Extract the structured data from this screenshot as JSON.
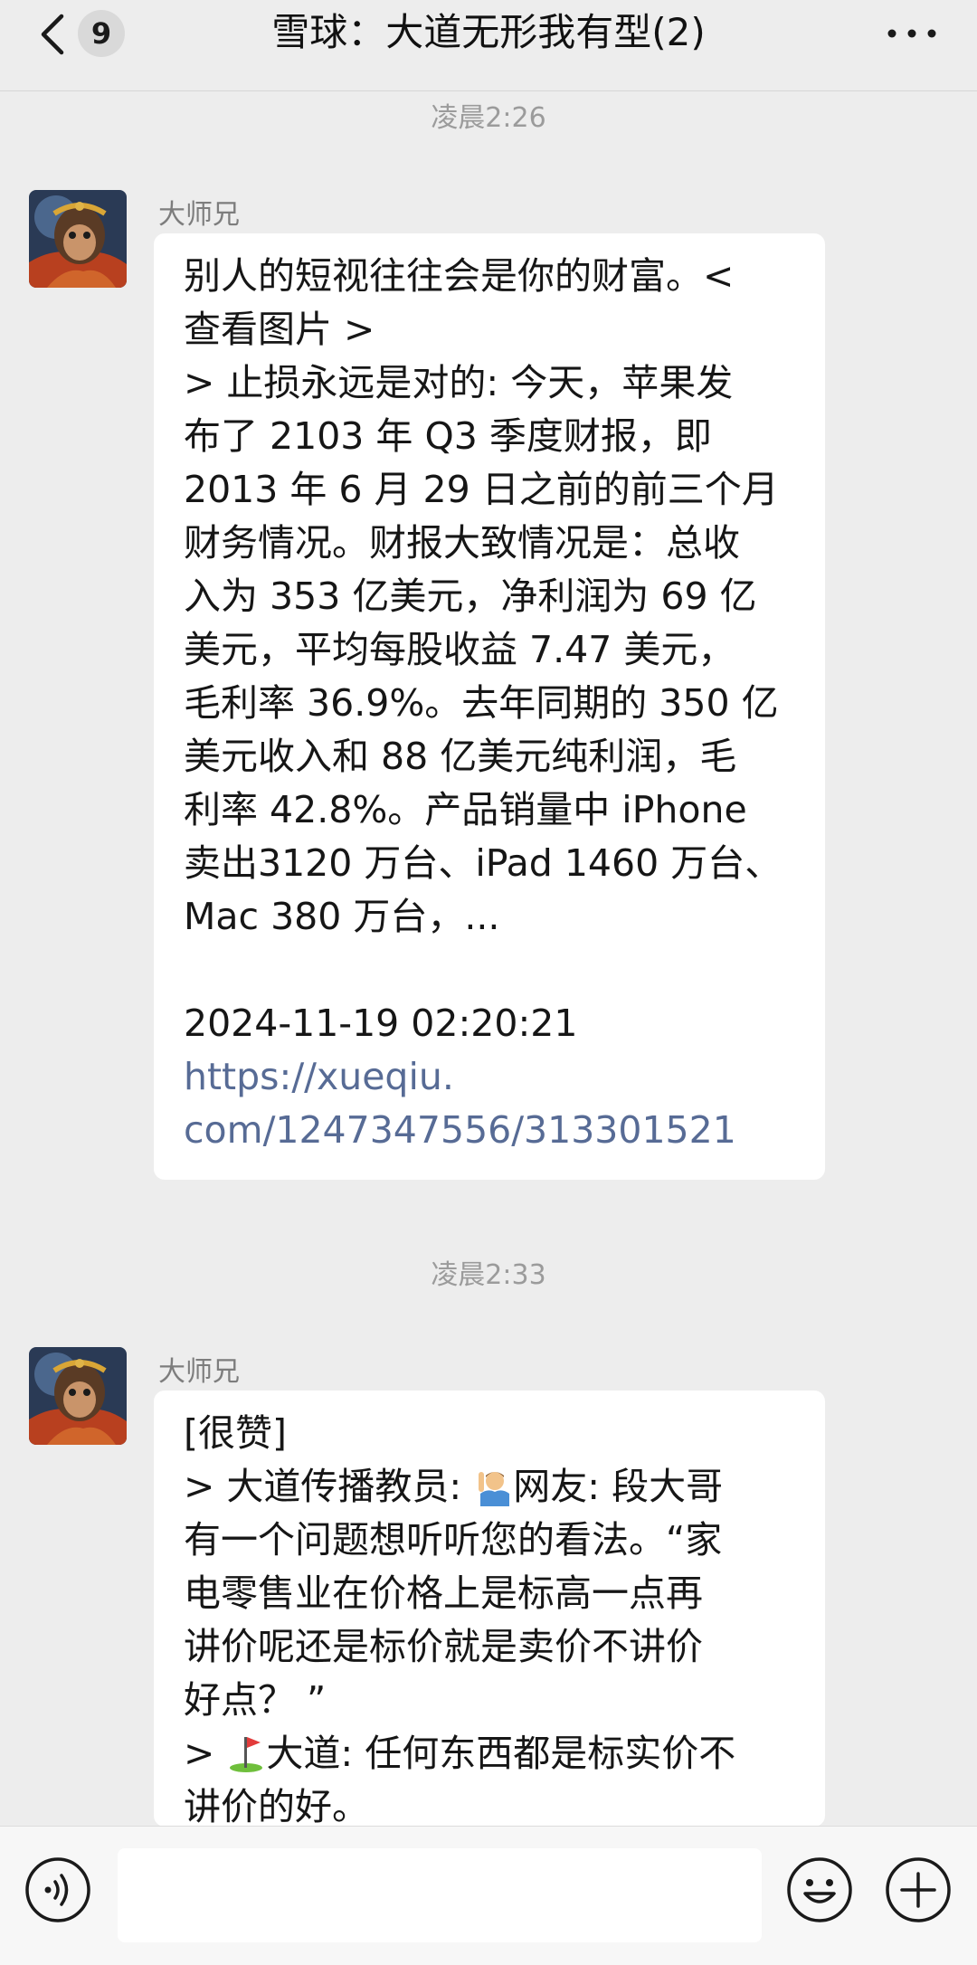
{
  "header": {
    "unread_count": "9",
    "title": "雪球：大道无形我有型(2)",
    "back_icon": "chevron-left-icon",
    "more_icon": "more-dots-icon"
  },
  "messages": [
    {
      "time": "凌晨2:26",
      "sender": "大师兄",
      "lines": [
        "别人的短视往往会是你的财富。<",
        "查看图片 >",
        "> 止损永远是对的: 今天，苹果发",
        "布了 2103 年 Q3 季度财报，即",
        "2013 年 6 月 29 日之前的前三个月",
        "财务情况。财报大致情况是：总收",
        "入为 353 亿美元，净利润为 69 亿",
        "美元，平均每股收益 7.47 美元，",
        "毛利率 36.9%。去年同期的 350 亿",
        "美元收入和 88 亿美元纯利润，毛",
        "利率 42.8%。产品销量中 iPhone",
        "卖出3120 万台、iPad 1460 万台、",
        "Mac 380 万台，..."
      ],
      "datetime": "2024-11-19 02:20:21",
      "link_lines": [
        "https://xueqiu.",
        "com/1247347556/313301521"
      ]
    },
    {
      "time": "凌晨2:33",
      "sender": "大师兄",
      "line1": "[很赞]",
      "line2_a": "> 大道传播教员: ",
      "line2_b": "网友: 段大哥",
      "lines_mid": [
        "有一个问题想听听您的看法。“家",
        "电零售业在价格上是标高一点再",
        "讲价呢还是标价就是卖价不讲价",
        "好点？ ”"
      ],
      "line_last_a": "> ",
      "line_last_b": "大道: 任何东西都是标实价不",
      "line_cut": "讲价的好。"
    }
  ],
  "input_bar": {
    "placeholder": "",
    "voice_icon": "voice-icon",
    "emoji_icon": "emoji-icon",
    "plus_icon": "plus-icon"
  },
  "colors": {
    "background": "#ededed",
    "bubble": "#ffffff",
    "link": "#576b95",
    "meta_text": "#9b9b9b"
  }
}
